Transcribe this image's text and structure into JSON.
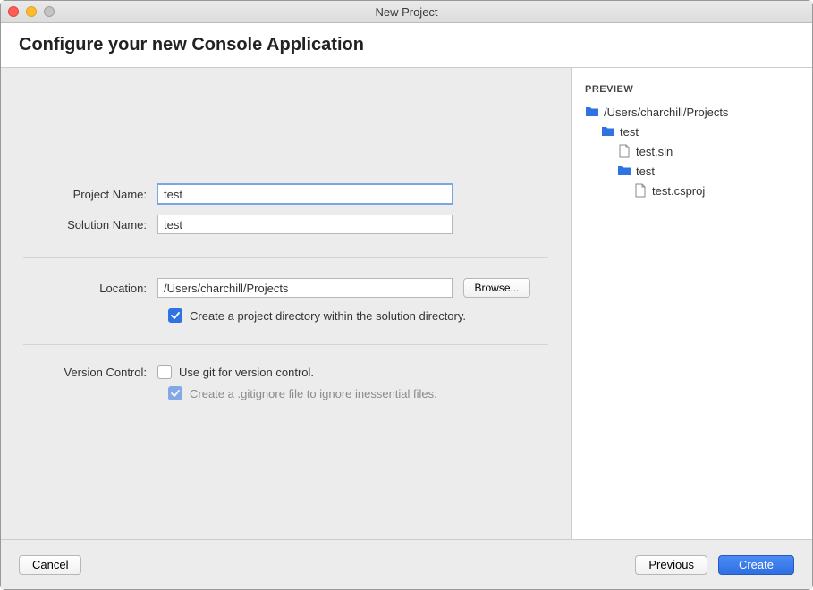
{
  "window": {
    "title": "New Project"
  },
  "header": {
    "title": "Configure your new Console Application"
  },
  "form": {
    "project_name_label": "Project Name:",
    "project_name_value": "test",
    "solution_name_label": "Solution Name:",
    "solution_name_value": "test",
    "location_label": "Location:",
    "location_value": "/Users/charchill/Projects",
    "browse_label": "Browse...",
    "create_project_dir_label": "Create a project directory within the solution directory.",
    "version_control_label": "Version Control:",
    "use_git_label": "Use git for version control.",
    "gitignore_label": "Create a .gitignore file to ignore inessential files."
  },
  "preview": {
    "title": "PREVIEW",
    "root": "/Users/charchill/Projects",
    "folder1": "test",
    "file1": "test.sln",
    "folder2": "test",
    "file2": "test.csproj"
  },
  "footer": {
    "cancel_label": "Cancel",
    "previous_label": "Previous",
    "create_label": "Create"
  }
}
